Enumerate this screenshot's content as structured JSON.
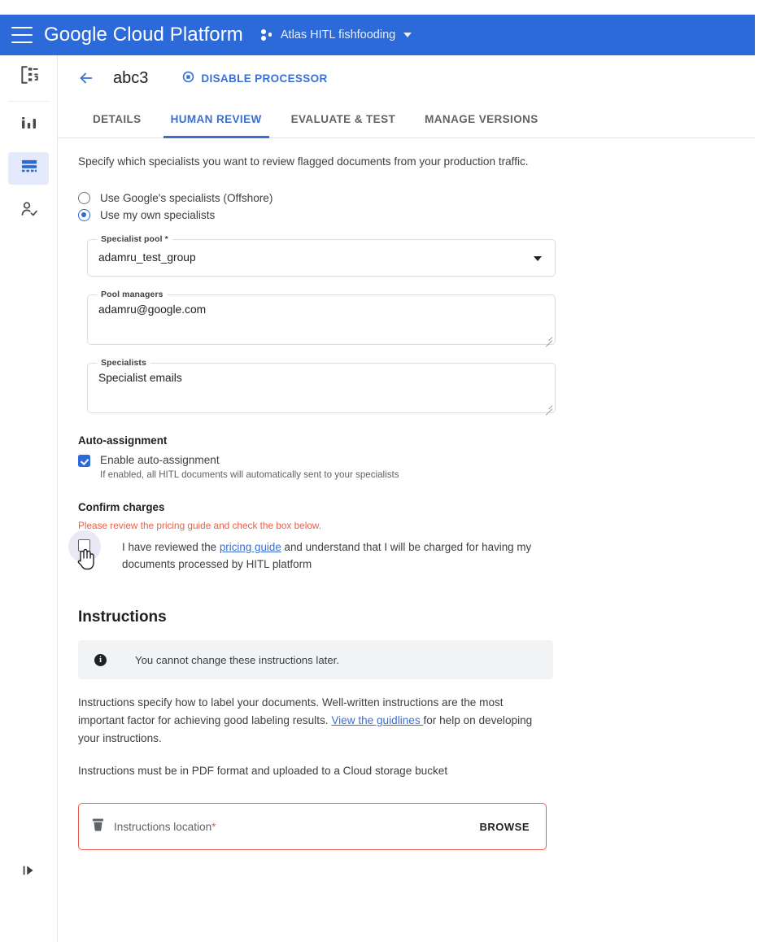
{
  "topbar": {
    "menu_icon": "hamburger-icon",
    "product_title": "Google Cloud Platform",
    "project_name": "Atlas HITL fishfooding",
    "project_icon": "project-dots-icon",
    "caret_icon": "chevron-down-icon",
    "accent_color": "#2b6ad8"
  },
  "rail": {
    "items": [
      {
        "icon": "document-processor-icon",
        "active": false
      },
      {
        "icon": "dashboard-bars-icon",
        "active": false
      },
      {
        "icon": "table-form-icon",
        "active": true
      },
      {
        "icon": "person-check-icon",
        "active": false
      }
    ],
    "expand_icon": "expand-panel-icon"
  },
  "page_header": {
    "back_icon": "back-arrow-icon",
    "title": "abc3",
    "action_icon": "stop-circle-icon",
    "action_label": "DISABLE PROCESSOR",
    "action_color": "#3b6fd4"
  },
  "tabs": [
    {
      "label": "DETAILS",
      "active": false
    },
    {
      "label": "HUMAN REVIEW",
      "active": true
    },
    {
      "label": "EVALUATE & TEST",
      "active": false
    },
    {
      "label": "MANAGE VERSIONS",
      "active": false
    }
  ],
  "main": {
    "intro": "Specify which specialists you want to review flagged documents from your production traffic.",
    "radios": [
      {
        "label": "Use Google's specialists (Offshore)",
        "checked": false
      },
      {
        "label": "Use my own specialists",
        "checked": true
      }
    ],
    "specialist_pool": {
      "label": "Specialist pool *",
      "value": "adamru_test_group",
      "caret_icon": "chevron-down-icon"
    },
    "pool_managers": {
      "label": "Pool managers",
      "value": "adamru@google.com"
    },
    "specialists": {
      "label": "Specialists",
      "value": "Specialist emails"
    },
    "auto_assignment": {
      "title": "Auto-assignment",
      "checkbox_label": "Enable auto-assignment",
      "checked": true,
      "helper": "If enabled, all HITL documents will automatically sent to your specialists"
    },
    "confirm_charges": {
      "title": "Confirm charges",
      "error": "Please review the pricing guide and check the box below.",
      "error_color": "#e8604a",
      "checked": false,
      "text_before": "I have reviewed the ",
      "link_text": "pricing guide",
      "text_after": " and understand that I will be charged for having my documents processed by HITL platform",
      "cursor_icon": "hand-pointer-cursor"
    },
    "instructions": {
      "heading": "Instructions",
      "banner_icon": "info-icon",
      "banner_text": "You cannot change these instructions later.",
      "paragraph_before": "Instructions specify how to label your documents. Well-written instructions are the most important factor for achieving good labeling results. ",
      "paragraph_link": "View the guidlines ",
      "paragraph_after": "for help on developing your instructions.",
      "format_note": "Instructions must be in PDF format and uploaded to a Cloud storage bucket",
      "location_field": {
        "bucket_icon": "storage-bucket-icon",
        "placeholder": "Instructions location",
        "required_mark": "*",
        "browse_label": "BROWSE",
        "border_color": "#e8604a"
      }
    }
  }
}
